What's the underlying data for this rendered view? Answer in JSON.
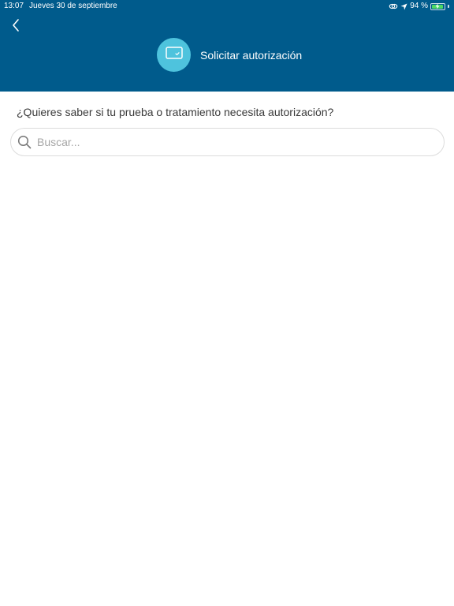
{
  "status_bar": {
    "time": "13:07",
    "date": "Jueves 30 de septiembre",
    "battery": "94 %",
    "icons": [
      "cloud-link-icon",
      "location-arrow-icon",
      "battery-icon"
    ]
  },
  "header": {
    "title": "Solicitar autorización",
    "icon": "tablet-check-icon",
    "background": "#005b8c",
    "icon_background": "#4ec3dd"
  },
  "main": {
    "question": "¿Quieres saber si tu prueba o tratamiento necesita autorización?"
  },
  "search": {
    "value": "",
    "placeholder": "Buscar..."
  }
}
